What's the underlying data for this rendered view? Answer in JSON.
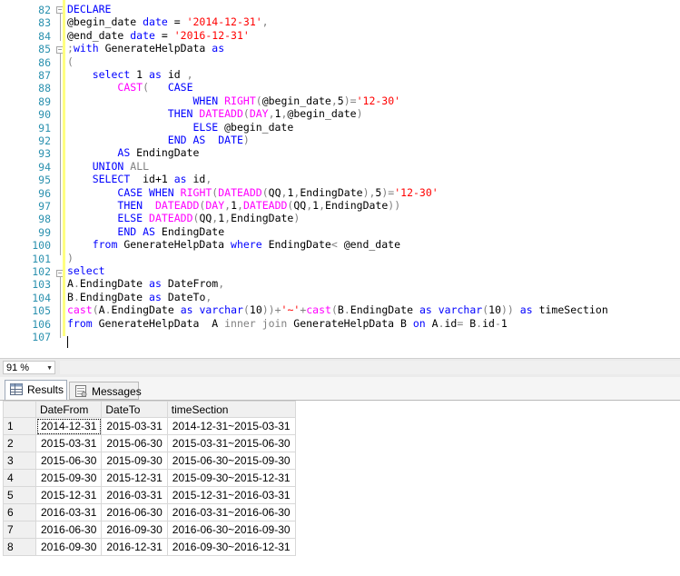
{
  "editor": {
    "lines": [
      {
        "n": "82",
        "segs": [
          [
            "k",
            "DECLARE"
          ]
        ]
      },
      {
        "n": "83",
        "segs": [
          [
            "",
            "@begin_date "
          ],
          [
            "k",
            "date"
          ],
          [
            "",
            " = "
          ],
          [
            "s",
            "'2014-12-31'"
          ],
          [
            "g",
            ","
          ]
        ]
      },
      {
        "n": "84",
        "segs": [
          [
            "",
            "@end_date "
          ],
          [
            "k",
            "date"
          ],
          [
            "",
            " = "
          ],
          [
            "s",
            "'2016-12-31'"
          ]
        ]
      },
      {
        "n": "85",
        "segs": [
          [
            "g",
            ";"
          ],
          [
            "k",
            "with"
          ],
          [
            "",
            " GenerateHelpData "
          ],
          [
            "k",
            "as"
          ]
        ]
      },
      {
        "n": "86",
        "segs": [
          [
            "g",
            "("
          ]
        ]
      },
      {
        "n": "87",
        "segs": [
          [
            "",
            "    "
          ],
          [
            "k",
            "select"
          ],
          [
            "",
            " 1 "
          ],
          [
            "k",
            "as"
          ],
          [
            "",
            " id "
          ],
          [
            "g",
            ","
          ]
        ]
      },
      {
        "n": "88",
        "segs": [
          [
            "",
            "        "
          ],
          [
            "f",
            "CAST"
          ],
          [
            "g",
            "("
          ],
          [
            "",
            "   "
          ],
          [
            "k",
            "CASE"
          ]
        ]
      },
      {
        "n": "89",
        "segs": [
          [
            "",
            "                    "
          ],
          [
            "k",
            "WHEN"
          ],
          [
            "",
            " "
          ],
          [
            "f",
            "RIGHT"
          ],
          [
            "g",
            "("
          ],
          [
            "",
            "@begin_date"
          ],
          [
            "g",
            ","
          ],
          [
            "",
            "5"
          ],
          [
            "g",
            ")="
          ],
          [
            "s",
            "'12-30'"
          ]
        ]
      },
      {
        "n": "90",
        "segs": [
          [
            "",
            "                "
          ],
          [
            "k",
            "THEN"
          ],
          [
            "",
            " "
          ],
          [
            "f",
            "DATEADD"
          ],
          [
            "g",
            "("
          ],
          [
            "f",
            "DAY"
          ],
          [
            "g",
            ","
          ],
          [
            "",
            "1"
          ],
          [
            "g",
            ","
          ],
          [
            "",
            "@begin_date"
          ],
          [
            "g",
            ")"
          ]
        ]
      },
      {
        "n": "91",
        "segs": [
          [
            "",
            "                    "
          ],
          [
            "k",
            "ELSE"
          ],
          [
            "",
            " @begin_date"
          ]
        ]
      },
      {
        "n": "92",
        "segs": [
          [
            "",
            "                "
          ],
          [
            "k",
            "END"
          ],
          [
            "",
            " "
          ],
          [
            "k",
            "AS"
          ],
          [
            "",
            "  "
          ],
          [
            "k",
            "DATE"
          ],
          [
            "g",
            ")"
          ]
        ]
      },
      {
        "n": "93",
        "segs": [
          [
            "",
            "        "
          ],
          [
            "k",
            "AS"
          ],
          [
            "",
            " EndingDate"
          ]
        ]
      },
      {
        "n": "94",
        "segs": [
          [
            "",
            "    "
          ],
          [
            "k",
            "UNION"
          ],
          [
            "",
            " "
          ],
          [
            "g",
            "ALL"
          ]
        ]
      },
      {
        "n": "95",
        "segs": [
          [
            "",
            "    "
          ],
          [
            "k",
            "SELECT"
          ],
          [
            "",
            "  id+1 "
          ],
          [
            "k",
            "as"
          ],
          [
            "",
            " id"
          ],
          [
            "g",
            ","
          ]
        ]
      },
      {
        "n": "96",
        "segs": [
          [
            "",
            "        "
          ],
          [
            "k",
            "CASE"
          ],
          [
            "",
            " "
          ],
          [
            "k",
            "WHEN"
          ],
          [
            "",
            " "
          ],
          [
            "f",
            "RIGHT"
          ],
          [
            "g",
            "("
          ],
          [
            "f",
            "DATEADD"
          ],
          [
            "g",
            "("
          ],
          [
            "",
            "QQ"
          ],
          [
            "g",
            ","
          ],
          [
            "",
            "1"
          ],
          [
            "g",
            ","
          ],
          [
            "",
            "EndingDate"
          ],
          [
            "g",
            "),"
          ],
          [
            "",
            "5"
          ],
          [
            "g",
            ")="
          ],
          [
            "s",
            "'12-30'"
          ]
        ]
      },
      {
        "n": "97",
        "segs": [
          [
            "",
            "        "
          ],
          [
            "k",
            "THEN"
          ],
          [
            "",
            "  "
          ],
          [
            "f",
            "DATEADD"
          ],
          [
            "g",
            "("
          ],
          [
            "f",
            "DAY"
          ],
          [
            "g",
            ","
          ],
          [
            "",
            "1"
          ],
          [
            "g",
            ","
          ],
          [
            "f",
            "DATEADD"
          ],
          [
            "g",
            "("
          ],
          [
            "",
            "QQ"
          ],
          [
            "g",
            ","
          ],
          [
            "",
            "1"
          ],
          [
            "g",
            ","
          ],
          [
            "",
            "EndingDate"
          ],
          [
            "g",
            "))"
          ]
        ]
      },
      {
        "n": "98",
        "segs": [
          [
            "",
            "        "
          ],
          [
            "k",
            "ELSE"
          ],
          [
            "",
            " "
          ],
          [
            "f",
            "DATEADD"
          ],
          [
            "g",
            "("
          ],
          [
            "",
            "QQ"
          ],
          [
            "g",
            ","
          ],
          [
            "",
            "1"
          ],
          [
            "g",
            ","
          ],
          [
            "",
            "EndingDate"
          ],
          [
            "g",
            ")"
          ]
        ]
      },
      {
        "n": "99",
        "segs": [
          [
            "",
            "        "
          ],
          [
            "k",
            "END"
          ],
          [
            "",
            " "
          ],
          [
            "k",
            "AS"
          ],
          [
            "",
            " EndingDate"
          ]
        ]
      },
      {
        "n": "100",
        "segs": [
          [
            "",
            "    "
          ],
          [
            "k",
            "from"
          ],
          [
            "",
            " GenerateHelpData "
          ],
          [
            "k",
            "where"
          ],
          [
            "",
            " EndingDate"
          ],
          [
            "g",
            "<"
          ],
          [
            "",
            " @end_date"
          ]
        ]
      },
      {
        "n": "101",
        "segs": [
          [
            "g",
            ")"
          ]
        ]
      },
      {
        "n": "102",
        "segs": [
          [
            "k",
            "select"
          ]
        ]
      },
      {
        "n": "103",
        "segs": [
          [
            "",
            "A"
          ],
          [
            "g",
            "."
          ],
          [
            "",
            "EndingDate "
          ],
          [
            "k",
            "as"
          ],
          [
            "",
            " DateFrom"
          ],
          [
            "g",
            ","
          ]
        ]
      },
      {
        "n": "104",
        "segs": [
          [
            "",
            "B"
          ],
          [
            "g",
            "."
          ],
          [
            "",
            "EndingDate "
          ],
          [
            "k",
            "as"
          ],
          [
            "",
            " DateTo"
          ],
          [
            "g",
            ","
          ]
        ]
      },
      {
        "n": "105",
        "segs": [
          [
            "f",
            "cast"
          ],
          [
            "g",
            "("
          ],
          [
            "",
            "A"
          ],
          [
            "g",
            "."
          ],
          [
            "",
            "EndingDate "
          ],
          [
            "k",
            "as"
          ],
          [
            "",
            " "
          ],
          [
            "k",
            "varchar"
          ],
          [
            "g",
            "("
          ],
          [
            "",
            "10"
          ],
          [
            "g",
            "))+"
          ],
          [
            "s",
            "'~'"
          ],
          [
            "g",
            "+"
          ],
          [
            "f",
            "cast"
          ],
          [
            "g",
            "("
          ],
          [
            "",
            "B"
          ],
          [
            "g",
            "."
          ],
          [
            "",
            "EndingDate "
          ],
          [
            "k",
            "as"
          ],
          [
            "",
            " "
          ],
          [
            "k",
            "varchar"
          ],
          [
            "g",
            "("
          ],
          [
            "",
            "10"
          ],
          [
            "g",
            "))"
          ],
          [
            "",
            " "
          ],
          [
            "k",
            "as"
          ],
          [
            "",
            " timeSection"
          ]
        ]
      },
      {
        "n": "106",
        "segs": [
          [
            "k",
            "from"
          ],
          [
            "",
            " GenerateHelpData  A "
          ],
          [
            "g",
            "inner join"
          ],
          [
            "",
            " GenerateHelpData B "
          ],
          [
            "k",
            "on"
          ],
          [
            "",
            " A"
          ],
          [
            "g",
            "."
          ],
          [
            "",
            "id"
          ],
          [
            "g",
            "="
          ],
          [
            "",
            " B"
          ],
          [
            "g",
            "."
          ],
          [
            "",
            "id"
          ],
          [
            "g",
            "-"
          ],
          [
            "",
            "1"
          ]
        ]
      },
      {
        "n": "107",
        "segs": []
      }
    ]
  },
  "zoom": {
    "value": "91 %"
  },
  "tabs": {
    "results": "Results",
    "messages": "Messages"
  },
  "grid": {
    "columns": [
      "DateFrom",
      "DateTo",
      "timeSection"
    ],
    "rows": [
      [
        "1",
        "2014-12-31",
        "2015-03-31",
        "2014-12-31~2015-03-31"
      ],
      [
        "2",
        "2015-03-31",
        "2015-06-30",
        "2015-03-31~2015-06-30"
      ],
      [
        "3",
        "2015-06-30",
        "2015-09-30",
        "2015-06-30~2015-09-30"
      ],
      [
        "4",
        "2015-09-30",
        "2015-12-31",
        "2015-09-30~2015-12-31"
      ],
      [
        "5",
        "2015-12-31",
        "2016-03-31",
        "2015-12-31~2016-03-31"
      ],
      [
        "6",
        "2016-03-31",
        "2016-06-30",
        "2016-03-31~2016-06-30"
      ],
      [
        "7",
        "2016-06-30",
        "2016-09-30",
        "2016-06-30~2016-09-30"
      ],
      [
        "8",
        "2016-09-30",
        "2016-12-31",
        "2016-09-30~2016-12-31"
      ]
    ]
  }
}
